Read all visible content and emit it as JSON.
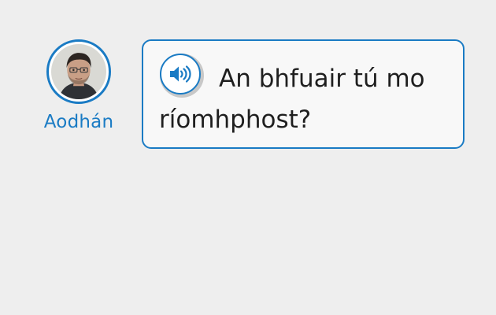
{
  "speaker": {
    "name": "Aodhán",
    "accent_color": "#1a7bc4"
  },
  "message": {
    "text": "An bhfuair tú mo ríomhphost?",
    "audio_icon": "speaker-volume-icon"
  }
}
